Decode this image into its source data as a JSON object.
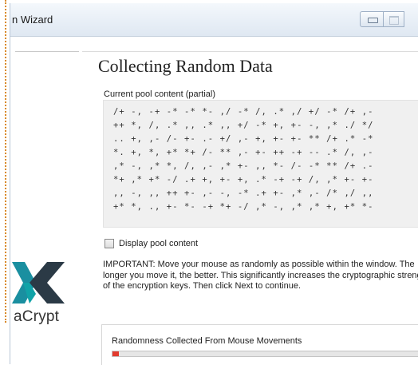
{
  "window": {
    "title": "n Wizard"
  },
  "sidebar": {
    "logo_text": "aCrypt",
    "logo_icon": "veracrypt-logo-icon"
  },
  "main": {
    "heading": "Collecting Random Data",
    "pool_label": "Current pool content (partial)",
    "pool_lines": [
      "/+ -, -+ -* -* *- ,/ -* /, .* ,/ +/ -* /+ ,-",
      "++ *, /, .* ,, .* ,, +/ -* +, +- -, ,* ./ */",
      ".. +, ,- /- +- .- +/ ,- +, +- +- ** /+ .* -*",
      "*. +, *, +* *+ /- ** ,- +- ++ -+ -- .* /, ,-",
      ",* -, ,* *, /, ,- ,* +- ,, *- /- -* ** /+ .-",
      "*+ ,* +* -/ .+ +, +- +, .* -+ -+ /, ,* +- +-",
      ",, -, ,, ++ +- ,- -, -* .+ +- ,* ,- /* ,/ ,,",
      "+* *, ., +- *- -+ *+ -/ ,* -, ,* ,* +, +* *-"
    ],
    "display_pool_label": "Display pool content",
    "display_pool_checked": false,
    "important_text": "IMPORTANT: Move your mouse as randomly as possible within the window. The longer you move it, the better. This significantly increases the cryptographic strength of the encryption keys. Then click Next to continue.",
    "randomness_label": "Randomness Collected From Mouse Movements",
    "randomness_progress_fraction": 0.01,
    "progress_color": "#e23b2e"
  }
}
